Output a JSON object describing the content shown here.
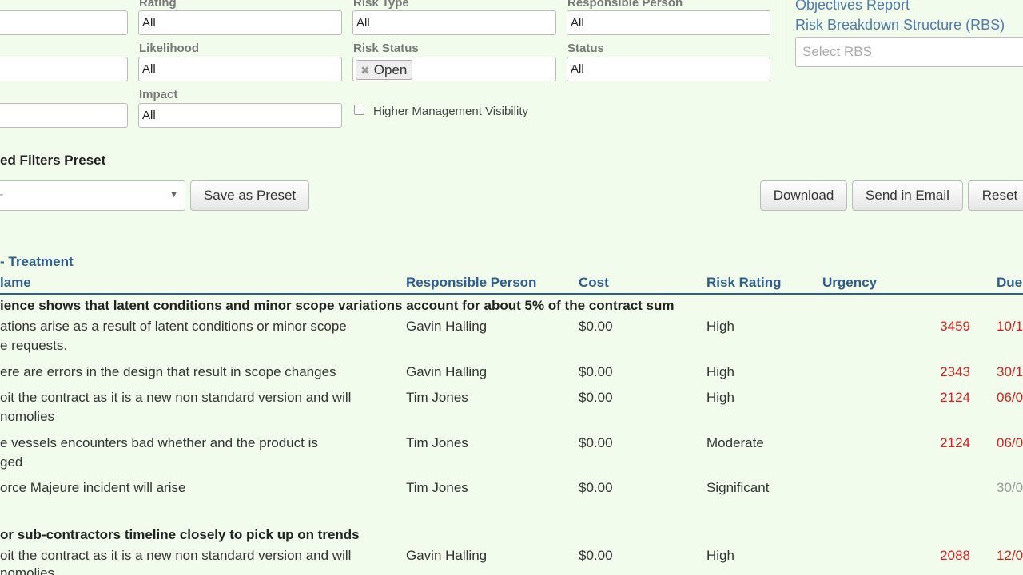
{
  "filters": {
    "rating": {
      "label": "Rating",
      "value": "All"
    },
    "likelihood": {
      "label": "Likelihood",
      "value": "All"
    },
    "impact": {
      "label": "Impact",
      "value": "All"
    },
    "risk_type": {
      "label": "Risk Type",
      "value": "All"
    },
    "risk_status": {
      "label": "Risk Status",
      "tag": "Open"
    },
    "higher_mgmt": {
      "label": "Higher Management Visibility"
    },
    "responsible": {
      "label": "Responsible Person",
      "value": "All"
    },
    "status": {
      "label": "Status",
      "value": "All"
    },
    "objectives_report": "Objectives Report",
    "rbs": {
      "label": "Risk Breakdown Structure (RBS)",
      "placeholder": "Select RBS"
    }
  },
  "preset": {
    "title": "ed Filters Preset",
    "select_value": "-",
    "save_label": "Save as Preset"
  },
  "actions": {
    "download": "Download",
    "email": "Send in Email",
    "reset": "Reset"
  },
  "table": {
    "section_title": "- Treatment",
    "headers": {
      "name": "lame",
      "responsible": "Responsible Person",
      "cost": "Cost",
      "rating": "Risk Rating",
      "urgency": "Urgency",
      "due": "Due"
    },
    "groups": [
      {
        "title": "ience shows that latent conditions and minor scope variations account for about 5% of the contract sum",
        "rows": [
          {
            "name1": "ations arise as a result of latent conditions or minor scope",
            "name2": "e requests.",
            "person": "Gavin Halling",
            "cost": "$0.00",
            "rating": "High",
            "urgency": "3459",
            "due": "10/1"
          },
          {
            "name1": "ere are errors in the design that result in scope changes",
            "name2": "",
            "person": "Gavin Halling",
            "cost": "$0.00",
            "rating": "High",
            "urgency": "2343",
            "due": "30/1"
          },
          {
            "name1": "oit the contract as it is a new non standard version and will",
            "name2": "nomolies",
            "person": "Tim Jones",
            "cost": "$0.00",
            "rating": "High",
            "urgency": "2124",
            "due": "06/0"
          },
          {
            "name1": "e vessels encounters bad whether and the product is",
            "name2": "ged",
            "person": "Tim Jones",
            "cost": "$0.00",
            "rating": "Moderate",
            "urgency": "2124",
            "due": "06/0"
          },
          {
            "name1": "orce Majeure incident will arise",
            "name2": "",
            "person": "Tim Jones",
            "cost": "$0.00",
            "rating": "Significant",
            "urgency": "",
            "due": "30/0"
          }
        ]
      },
      {
        "title": "or sub-contractors timeline closely to pick up on trends",
        "rows": [
          {
            "name1": "oit the contract as it is a new non standard version and will",
            "name2": "nomolies",
            "person": "Gavin Halling",
            "cost": "$0.00",
            "rating": "High",
            "urgency": "2088",
            "due": "12/0"
          }
        ]
      }
    ]
  },
  "colors": {
    "background": "#f2fcec",
    "link": "#4f7aa8",
    "heading": "#2e5d8e",
    "urgency": "#d62020"
  }
}
